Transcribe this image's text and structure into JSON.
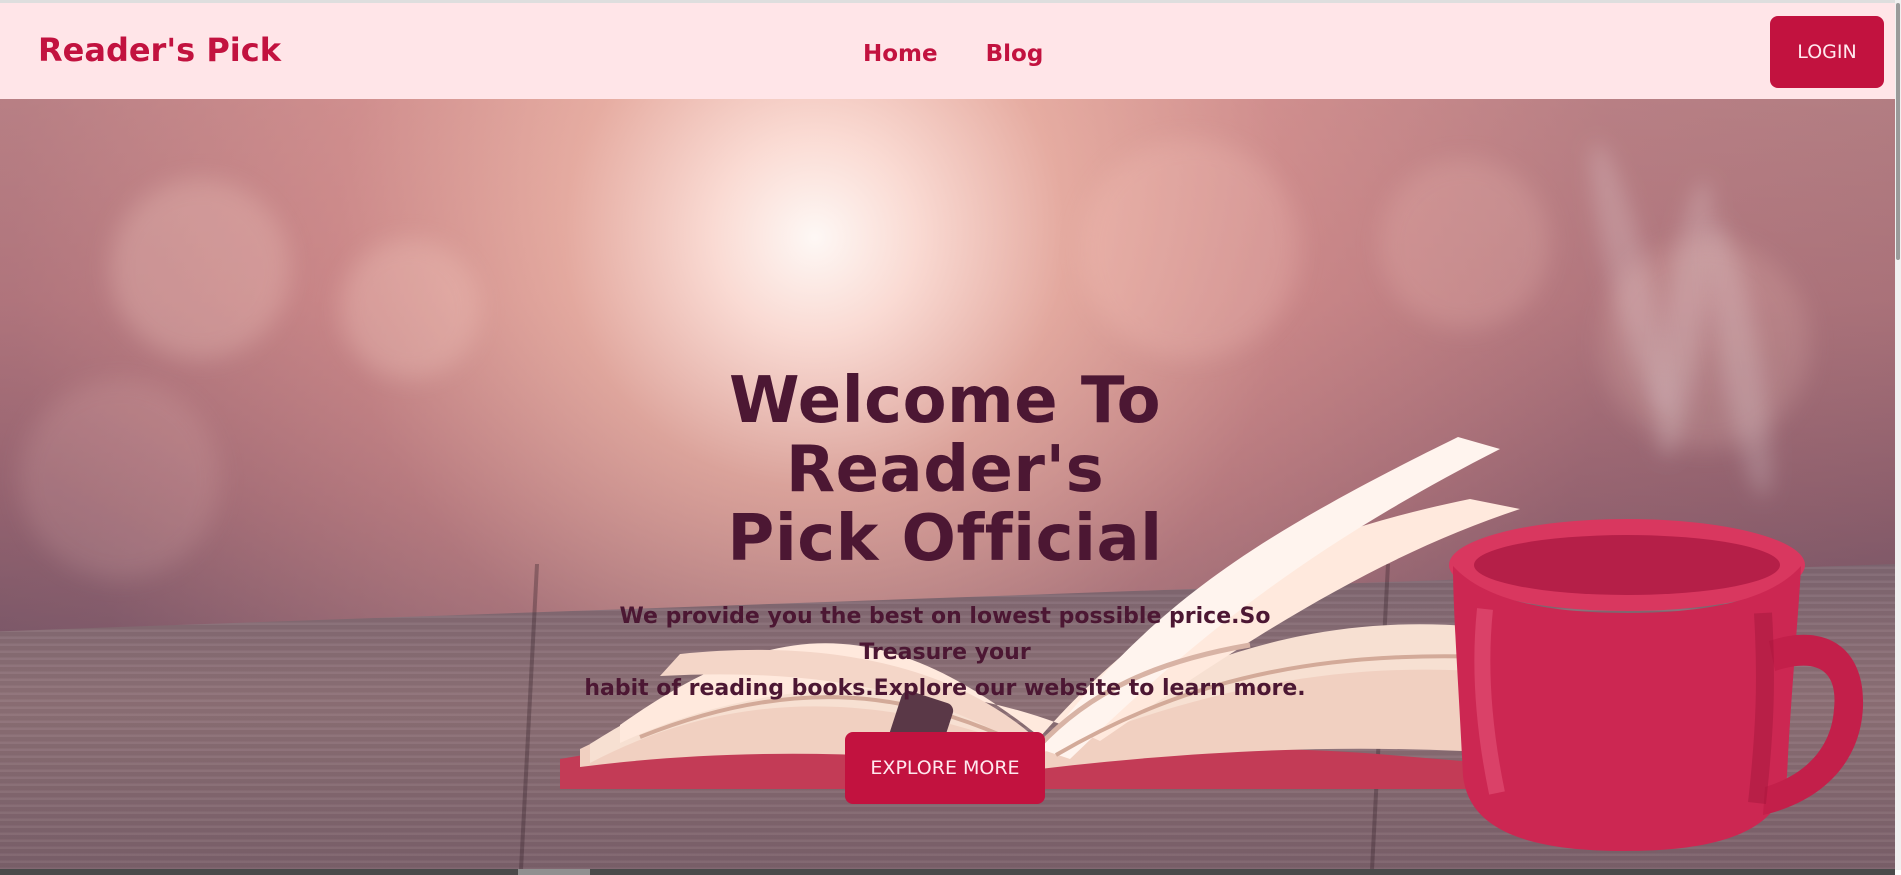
{
  "brand": {
    "name": "Reader's Pick"
  },
  "nav": {
    "links": [
      {
        "label": "Home"
      },
      {
        "label": "Blog"
      }
    ],
    "login_label": "LOGIN"
  },
  "hero": {
    "title_line_1": "Welcome To Reader's",
    "title_line_2": "Pick Official",
    "text_line_1": "We provide you the best on lowest possible price.So Treasure your",
    "text_line_2": "habit of reading books.Explore our website to learn more.",
    "button_label": "EXPLORE MORE"
  },
  "colors": {
    "primary": "#c2123f",
    "navbar": "#ffe5e8",
    "hero_text": "#4c1733"
  },
  "images": {
    "hero_background": "open-book-coffee-mug-illustration"
  }
}
